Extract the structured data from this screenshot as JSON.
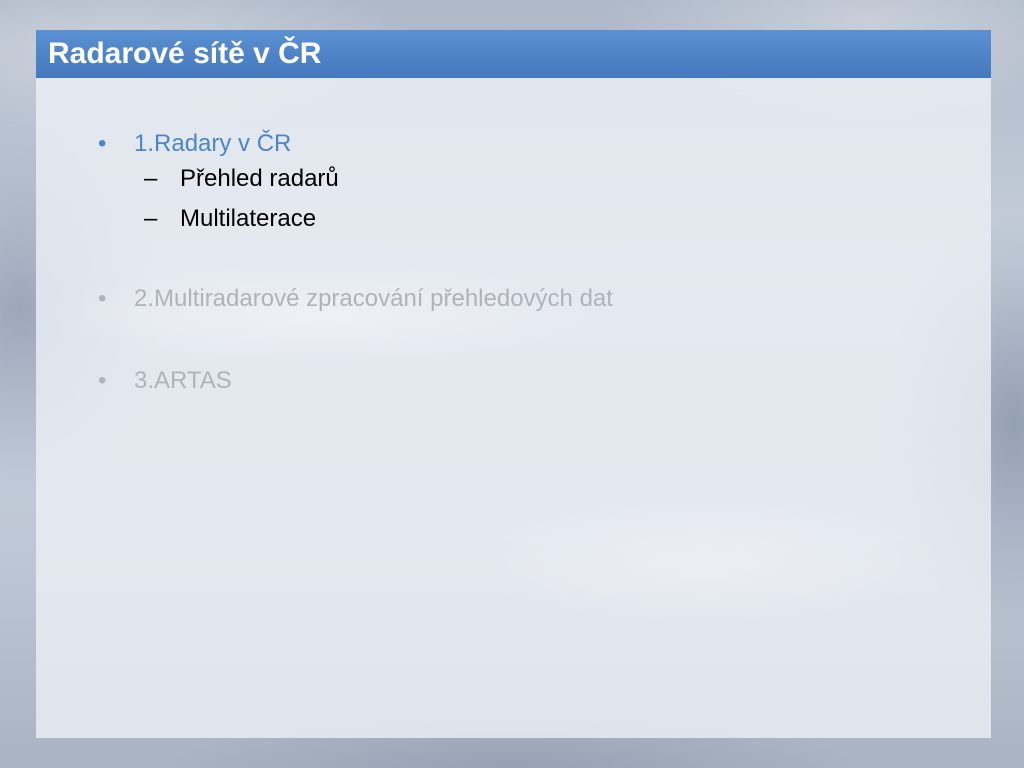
{
  "slide": {
    "title": "Radarové sítě v ČR",
    "items": [
      {
        "bullet": "•",
        "label": "1.Radary v ČR",
        "state": "active",
        "subitems": [
          {
            "dash": "–",
            "label": "Přehled radarů"
          },
          {
            "dash": "–",
            "label": "Multilaterace"
          }
        ]
      },
      {
        "bullet": "•",
        "label": "2.Multiradarové zpracování přehledových dat",
        "state": "dimmed"
      },
      {
        "bullet": "•",
        "label": "3.ARTAS",
        "state": "dimmed"
      }
    ]
  },
  "colors": {
    "title_bar": "#4a82c6",
    "active_text": "#4a86c8",
    "dimmed_text": "#b0b4ba"
  }
}
